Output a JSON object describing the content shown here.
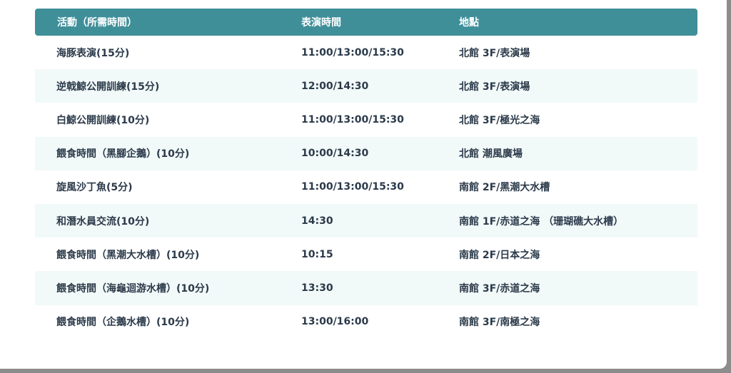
{
  "table": {
    "headers": [
      "活動（所需時間）",
      "表演時間",
      "地點"
    ],
    "rows": [
      {
        "activity": "海豚表演(15分)",
        "time": "11:00/13:00/15:30",
        "location": "北館 3F/表演場"
      },
      {
        "activity": "逆戟鯨公開訓練(15分)",
        "time": "12:00/14:30",
        "location": "北館 3F/表演場"
      },
      {
        "activity": "白鯨公開訓練(10分)",
        "time": "11:00/13:00/15:30",
        "location": "北館 3F/極光之海"
      },
      {
        "activity": "餵食時間（黑腳企鵝）(10分)",
        "time": "10:00/14:30",
        "location": "北館 潮風廣場"
      },
      {
        "activity": "旋風沙丁魚(5分)",
        "time": "11:00/13:00/15:30",
        "location": "南館 2F/黑潮大水槽"
      },
      {
        "activity": "和潛水員交流(10分)",
        "time": "14:30",
        "location": "南館 1F/赤道之海 （珊瑚礁大水槽）"
      },
      {
        "activity": "餵食時間（黑潮大水槽）(10分)",
        "time": "10:15",
        "location": "南館 2F/日本之海"
      },
      {
        "activity": "餵食時間（海龜迴游水槽）(10分)",
        "time": "13:30",
        "location": "南館 3F/赤道之海"
      },
      {
        "activity": "餵食時間（企鵝水槽）(10分)",
        "time": "13:00/16:00",
        "location": "南館 3F/南極之海"
      }
    ]
  },
  "colors": {
    "header_bg": "#3f8f99",
    "alt_row_bg": "#f2f9f9",
    "text": "#2b3a4a",
    "frame": "#8c8c8c"
  }
}
